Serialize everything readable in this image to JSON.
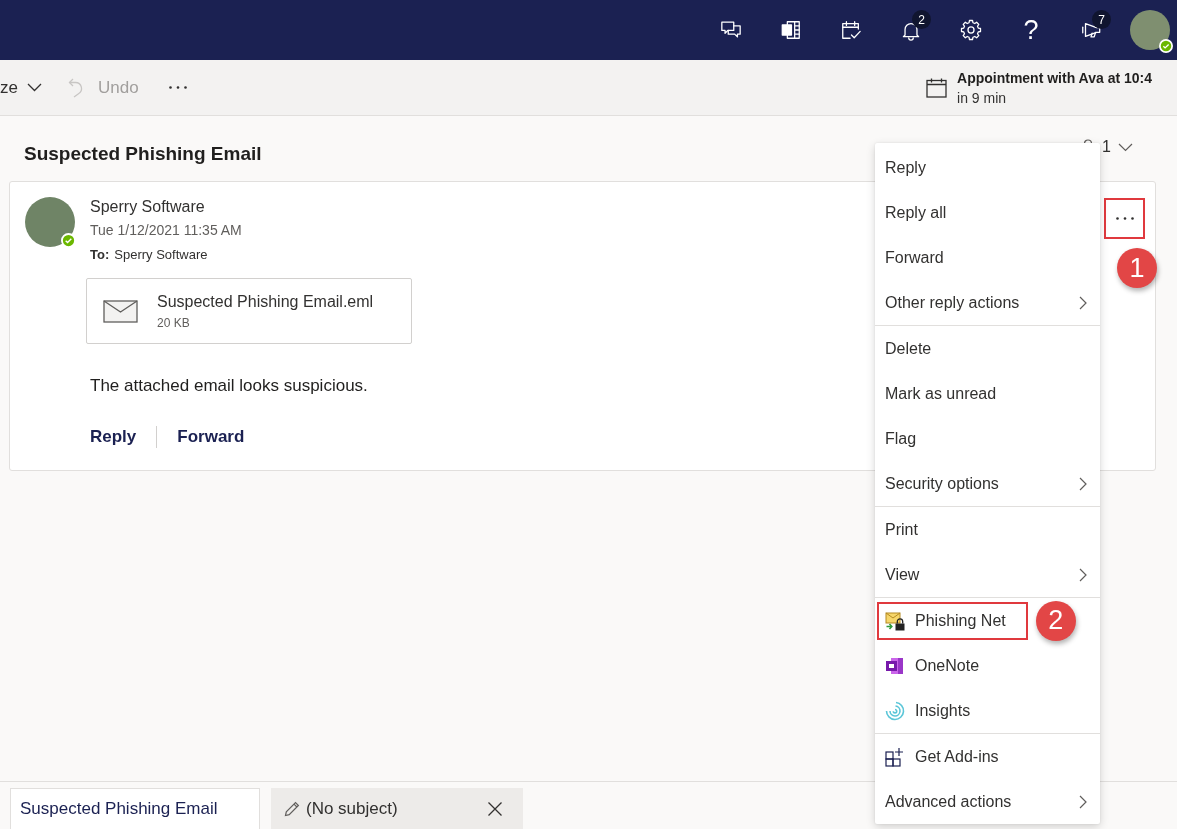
{
  "top_bar": {
    "buttons": [
      {
        "kind": "chat"
      },
      {
        "kind": "notebook"
      },
      {
        "kind": "tasks"
      },
      {
        "kind": "bell",
        "badge": "2"
      },
      {
        "kind": "settings"
      },
      {
        "kind": "help",
        "label": "?"
      },
      {
        "kind": "megaphone",
        "badge": "7"
      }
    ],
    "account": {
      "online": true
    }
  },
  "toolbar": {
    "items": [
      {
        "kind": "dropdown",
        "label": "ze",
        "disabled": false
      },
      {
        "kind": "undo",
        "label": "Undo",
        "disabled": true
      },
      {
        "kind": "more",
        "disabled": false
      }
    ],
    "reminder": {
      "title": "Appointment with Ava at 10:4",
      "subtitle": "in 9 min"
    }
  },
  "reading_pane": {
    "subject": "Suspected Phishing Email",
    "count": "1",
    "message": {
      "sender": "Sperry Software",
      "online": true,
      "date": "Tue 1/12/2021 11:35 AM",
      "to_label": "To:",
      "to": "Sperry Software",
      "attachment": {
        "name": "Suspected Phishing Email.eml",
        "size": "20 KB"
      },
      "body": "The attached email looks suspicious.",
      "actions": [
        "Reply",
        "Forward"
      ],
      "more_button": {
        "highlighted": true,
        "callout": "1"
      }
    }
  },
  "context_menu": {
    "sections": [
      {
        "items": [
          {
            "label": "Reply",
            "kind": "plain",
            "submenu": false,
            "highlighted": false
          },
          {
            "label": "Reply all",
            "kind": "plain",
            "submenu": false,
            "highlighted": false
          },
          {
            "label": "Forward",
            "kind": "plain",
            "submenu": false,
            "highlighted": false
          },
          {
            "label": "Other reply actions",
            "kind": "plain",
            "submenu": true,
            "highlighted": false
          }
        ]
      },
      {
        "items": [
          {
            "label": "Delete",
            "kind": "plain",
            "submenu": false,
            "highlighted": false
          },
          {
            "label": "Mark as unread",
            "kind": "plain",
            "submenu": false,
            "highlighted": false
          },
          {
            "label": "Flag",
            "kind": "plain",
            "submenu": false,
            "highlighted": false
          },
          {
            "label": "Security options",
            "kind": "plain",
            "submenu": true,
            "highlighted": false
          }
        ]
      },
      {
        "items": [
          {
            "label": "Print",
            "kind": "plain",
            "submenu": false,
            "highlighted": false
          },
          {
            "label": "View",
            "kind": "plain",
            "submenu": true,
            "highlighted": false
          }
        ]
      },
      {
        "items": [
          {
            "label": "Phishing Net",
            "kind": "phishing",
            "submenu": false,
            "highlighted": true,
            "callout": "2"
          },
          {
            "label": "OneNote",
            "kind": "notebook",
            "submenu": false,
            "highlighted": false
          },
          {
            "label": "Insights",
            "kind": "insights",
            "submenu": false,
            "highlighted": false
          }
        ]
      },
      {
        "items": [
          {
            "label": "Get Add-ins",
            "kind": "addins",
            "submenu": false,
            "highlighted": false
          },
          {
            "label": "Advanced actions",
            "kind": "plain",
            "submenu": true,
            "highlighted": false
          }
        ]
      }
    ]
  },
  "tabs": [
    {
      "label": "Suspected Phishing Email",
      "kind": "message",
      "selected": true,
      "closable": false
    },
    {
      "label": "(No subject)",
      "kind": "draft",
      "selected": false,
      "closable": true
    }
  ]
}
